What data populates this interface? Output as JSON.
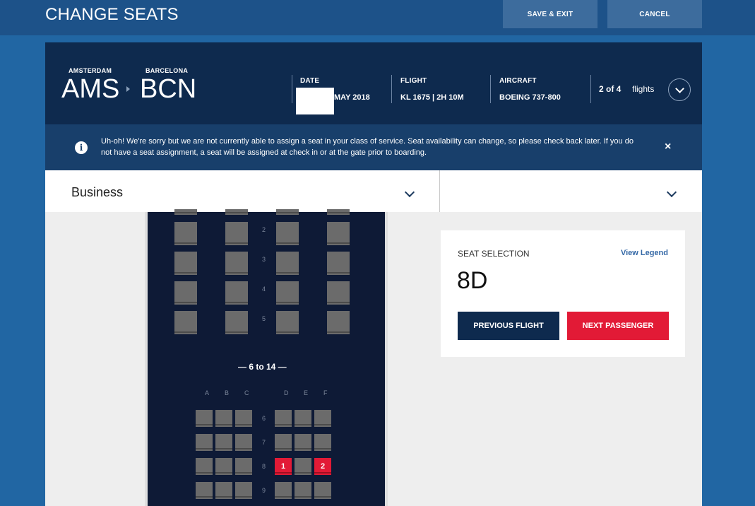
{
  "page": {
    "title": "CHANGE SEATS",
    "save_exit_label": "SAVE & EXIT",
    "cancel_label": "CANCEL"
  },
  "flight": {
    "origin_city": "AMSTERDAM",
    "origin_code": "AMS",
    "destination_city": "BARCELONA",
    "destination_code": "BCN",
    "date_label": "DATE",
    "date_value": "MAY 2018",
    "flight_label": "FLIGHT",
    "flight_value": "KL 1675 | 2H 10M",
    "aircraft_label": "AIRCRAFT",
    "aircraft_value": "BOEING 737-800",
    "flight_count": "2 of 4",
    "flights_word": "flights"
  },
  "alert": {
    "message": "Uh-oh! We're sorry but we are not currently able to assign a seat in your class of service. Seat availability can change, so please check back later. If you do not have a seat assignment, a seat will be assigned at check in or at the gate prior to boarding."
  },
  "cabin_selector": {
    "left_label": "Business",
    "right_label": ""
  },
  "seatmap": {
    "business_rows": [
      "2",
      "3",
      "4",
      "5"
    ],
    "range_label": "— 6 to 14 —",
    "columns": [
      "A",
      "B",
      "C",
      "D",
      "E",
      "F"
    ],
    "economy_rows": [
      "6",
      "7",
      "8",
      "9"
    ],
    "assigned": [
      {
        "row": "8",
        "seat": "D",
        "label": "1"
      },
      {
        "row": "8",
        "seat": "F",
        "label": "2"
      }
    ]
  },
  "selection": {
    "label": "SEAT SELECTION",
    "legend_link": "View Legend",
    "seat": "8D",
    "previous_flight_label": "PREVIOUS FLIGHT",
    "next_passenger_label": "NEXT PASSENGER"
  },
  "colors": {
    "page_bg": "#2166a3",
    "header_bg": "#0e2a4e",
    "cabin_bg": "#0e1a36",
    "seat_grey": "#6b6b6b",
    "assigned_red": "#e21a36",
    "primary_button": "#0e2a4e"
  }
}
